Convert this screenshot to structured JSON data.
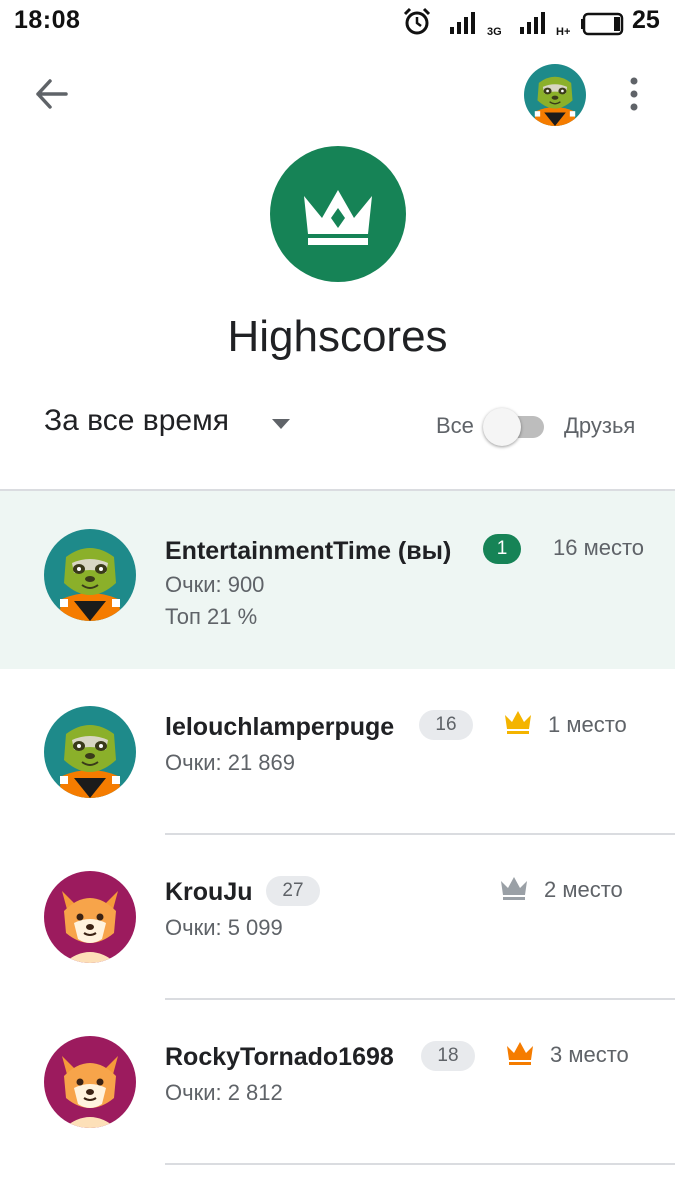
{
  "status_bar": {
    "time": "18:08",
    "network_label": "3G",
    "network_label_2": "H+",
    "battery_percent": "25",
    "icons": [
      "alarm-icon",
      "signal-icon",
      "signal-icon",
      "battery-icon"
    ]
  },
  "toolbar": {
    "back_icon": "arrow-back-icon",
    "overflow_icon": "more-vert-icon"
  },
  "header": {
    "title": "Highscores",
    "icon": "crown-icon",
    "accent_color": "#168356"
  },
  "filters": {
    "timeframe": "За все время",
    "toggle_left_label": "Все",
    "toggle_right_label": "Друзья",
    "toggle_on": false
  },
  "rows": [
    {
      "name": "EntertainmentTime (вы)",
      "badge": "1",
      "score": "Очки: 900",
      "top": "Топ 21 %",
      "place": "16 место",
      "crown": null,
      "avatar": "sloth-avatar",
      "highlighted": true
    },
    {
      "name": "lelouchlamperpuge",
      "badge": "16",
      "score": "Очки: 21 869",
      "place": "1 место",
      "crown": "gold",
      "avatar": "sloth-avatar"
    },
    {
      "name": "KrouJu",
      "badge": "27",
      "score": "Очки: 5 099",
      "place": "2 место",
      "crown": "silver",
      "avatar": "shiba-avatar"
    },
    {
      "name": "RockyTornado1698",
      "badge": "18",
      "score": "Очки: 2 812",
      "place": "3 место",
      "crown": "bronze",
      "avatar": "shiba-avatar"
    }
  ],
  "colors": {
    "gold": "#F4B400",
    "silver": "#9AA0A6",
    "bronze": "#F57C00"
  }
}
